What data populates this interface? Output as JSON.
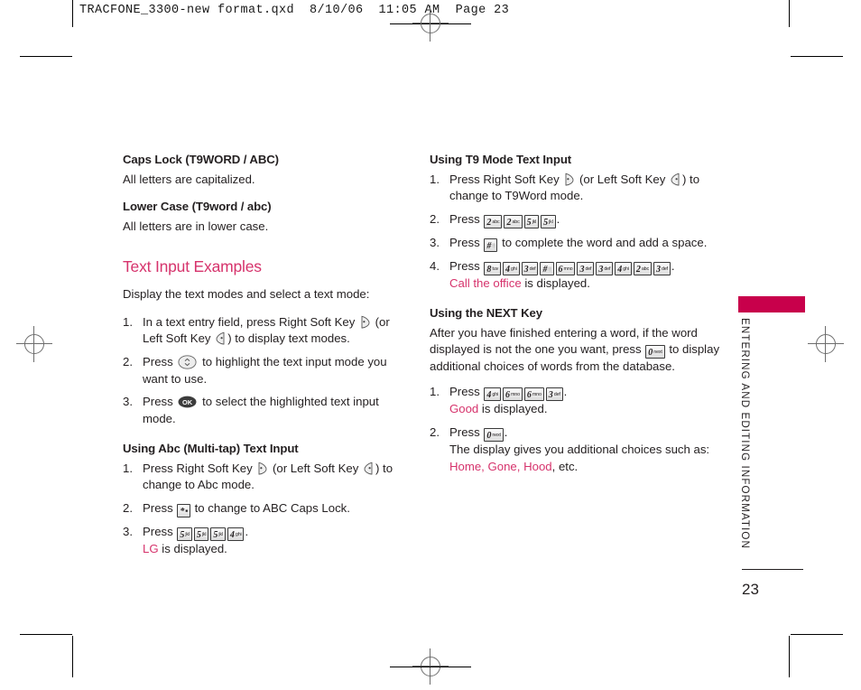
{
  "prepress": {
    "header": "TRACFONE_3300-new format.qxd  8/10/06  11:05 AM  Page 23"
  },
  "sidebar": {
    "running_title": "ENTERING AND EDITING INFORMATION",
    "page_number": "23",
    "tab_color": "#c8004b"
  },
  "theme": {
    "accent_pink": "#d6336c",
    "tab_crimson": "#c8004b",
    "text": "#231f20"
  },
  "left_column": {
    "caps_lock": {
      "heading": "Caps Lock (T9WORD / ABC)",
      "body": "All letters are capitalized."
    },
    "lower_case": {
      "heading": "Lower Case (T9word / abc)",
      "body": "All letters are in lower case."
    },
    "examples": {
      "heading": "Text Input Examples",
      "intro": "Display the text modes and select a text mode:",
      "step1_a": "In a text entry field, press Right Soft Key",
      "step1_b": "(or",
      "step1_c": "Left Soft Key",
      "step1_d": ") to display text modes.",
      "step2_a": "Press",
      "step2_b": "to highlight the text input mode you want to use.",
      "step3_a": "Press",
      "step3_b": "to select the highlighted text input mode.",
      "num1": "1.",
      "num2": "2.",
      "num3": "3."
    },
    "abc_mode": {
      "heading": "Using Abc (Multi-tap) Text Input",
      "num1": "1.",
      "num2": "2.",
      "num3": "3.",
      "step1_a": "Press Right Soft Key",
      "step1_b": "(or Left Soft Key",
      "step1_c": ") to change to Abc mode.",
      "step2_a": "Press",
      "step2_b": "to change to ABC Caps Lock.",
      "step3_a": "Press",
      "step3_keys": [
        {
          "digit": "5",
          "letters": "jkl"
        },
        {
          "digit": "5",
          "letters": "jkl"
        },
        {
          "digit": "5",
          "letters": "jkl"
        },
        {
          "digit": "4",
          "letters": "ghi"
        }
      ],
      "step3_period": ".",
      "result_word": "LG",
      "result_tail": " is displayed."
    }
  },
  "right_column": {
    "t9_mode": {
      "heading": "Using T9 Mode Text Input",
      "num1": "1.",
      "num2": "2.",
      "num3": "3.",
      "num4": "4.",
      "step1_a": "Press Right Soft Key",
      "step1_b": "(or Left Soft Key",
      "step1_c": ") to change to T9Word mode.",
      "step2_a": "Press",
      "step2_keys": [
        {
          "digit": "2",
          "letters": "abc"
        },
        {
          "digit": "2",
          "letters": "abc"
        },
        {
          "digit": "5",
          "letters": "jkl"
        },
        {
          "digit": "5",
          "letters": "jkl"
        }
      ],
      "step2_period": ".",
      "step3_a": "Press",
      "step3_b": "to complete the word and add a space.",
      "step4_a": "Press",
      "step4_keys": [
        {
          "digit": "8",
          "letters": "tuv"
        },
        {
          "digit": "4",
          "letters": "ghi"
        },
        {
          "digit": "3",
          "letters": "def"
        },
        {
          "digit": "#",
          "letters": "space"
        },
        {
          "digit": "6",
          "letters": "mno"
        },
        {
          "digit": "3",
          "letters": "def"
        },
        {
          "digit": "3",
          "letters": "def"
        },
        {
          "digit": "4",
          "letters": "ghi"
        },
        {
          "digit": "2",
          "letters": "abc"
        },
        {
          "digit": "3",
          "letters": "def"
        }
      ],
      "step4_period": ".",
      "result_word": "Call the office",
      "result_tail": " is displayed."
    },
    "next_key": {
      "heading": "Using the NEXT Key",
      "intro_a": "After you have finished entering a word, if the word displayed is not the one you want, press",
      "intro_b": "to display additional choices of words from the database.",
      "num1": "1.",
      "num2": "2.",
      "step1_a": "Press",
      "step1_keys": [
        {
          "digit": "4",
          "letters": "ghi"
        },
        {
          "digit": "6",
          "letters": "mno"
        },
        {
          "digit": "6",
          "letters": "mno"
        },
        {
          "digit": "3",
          "letters": "def"
        }
      ],
      "step1_period": ".",
      "result1_word": "Good",
      "result1_tail": " is displayed.",
      "step2_a": "Press",
      "step2_period": ".",
      "result2_intro": "The display gives you additional choices such as:",
      "result2_words": "Home, Gone, Hood",
      "result2_tail": ", etc."
    },
    "next_key_glyph": {
      "digit": "0",
      "letters": "next"
    }
  }
}
